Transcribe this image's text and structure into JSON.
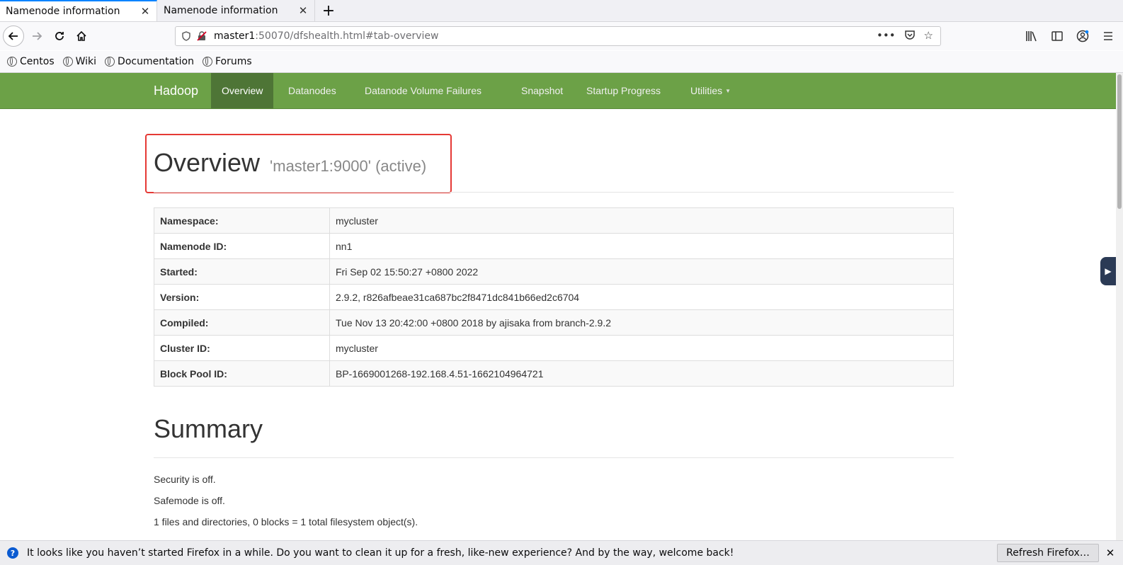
{
  "browser": {
    "tabs": [
      {
        "title": "Namenode information",
        "active": true
      },
      {
        "title": "Namenode information",
        "active": false
      }
    ],
    "url": {
      "host": "master1",
      "rest": ":50070/dfshealth.html#tab-overview"
    },
    "bookmarks": [
      "Centos",
      "Wiki",
      "Documentation",
      "Forums"
    ]
  },
  "page": {
    "brand": "Hadoop",
    "nav": [
      "Overview",
      "Datanodes",
      "Datanode Volume Failures",
      "Snapshot",
      "Startup Progress",
      "Utilities"
    ],
    "active_nav": "Overview",
    "overview": {
      "title": "Overview",
      "subtitle": "'master1:9000' (active)"
    },
    "info_table": [
      {
        "label": "Namespace:",
        "value": "mycluster"
      },
      {
        "label": "Namenode ID:",
        "value": "nn1"
      },
      {
        "label": "Started:",
        "value": "Fri Sep 02 15:50:27 +0800 2022"
      },
      {
        "label": "Version:",
        "value": "2.9.2, r826afbeae31ca687bc2f8471dc841b66ed2c6704"
      },
      {
        "label": "Compiled:",
        "value": "Tue Nov 13 20:42:00 +0800 2018 by ajisaka from branch-2.9.2"
      },
      {
        "label": "Cluster ID:",
        "value": "mycluster"
      },
      {
        "label": "Block Pool ID:",
        "value": "BP-1669001268-192.168.4.51-1662104964721"
      }
    ],
    "summary": {
      "title": "Summary",
      "lines": [
        "Security is off.",
        "Safemode is off.",
        "1 files and directories, 0 blocks = 1 total filesystem object(s)."
      ]
    }
  },
  "notification": {
    "message": "It looks like you haven’t started Firefox in a while. Do you want to clean it up for a fresh, like-new experience? And by the way, welcome back!",
    "button": "Refresh Firefox…"
  },
  "colors": {
    "hadoop_nav": "#6ca147",
    "hadoop_nav_active": "#4e7536",
    "highlight_box": "#e53935"
  }
}
